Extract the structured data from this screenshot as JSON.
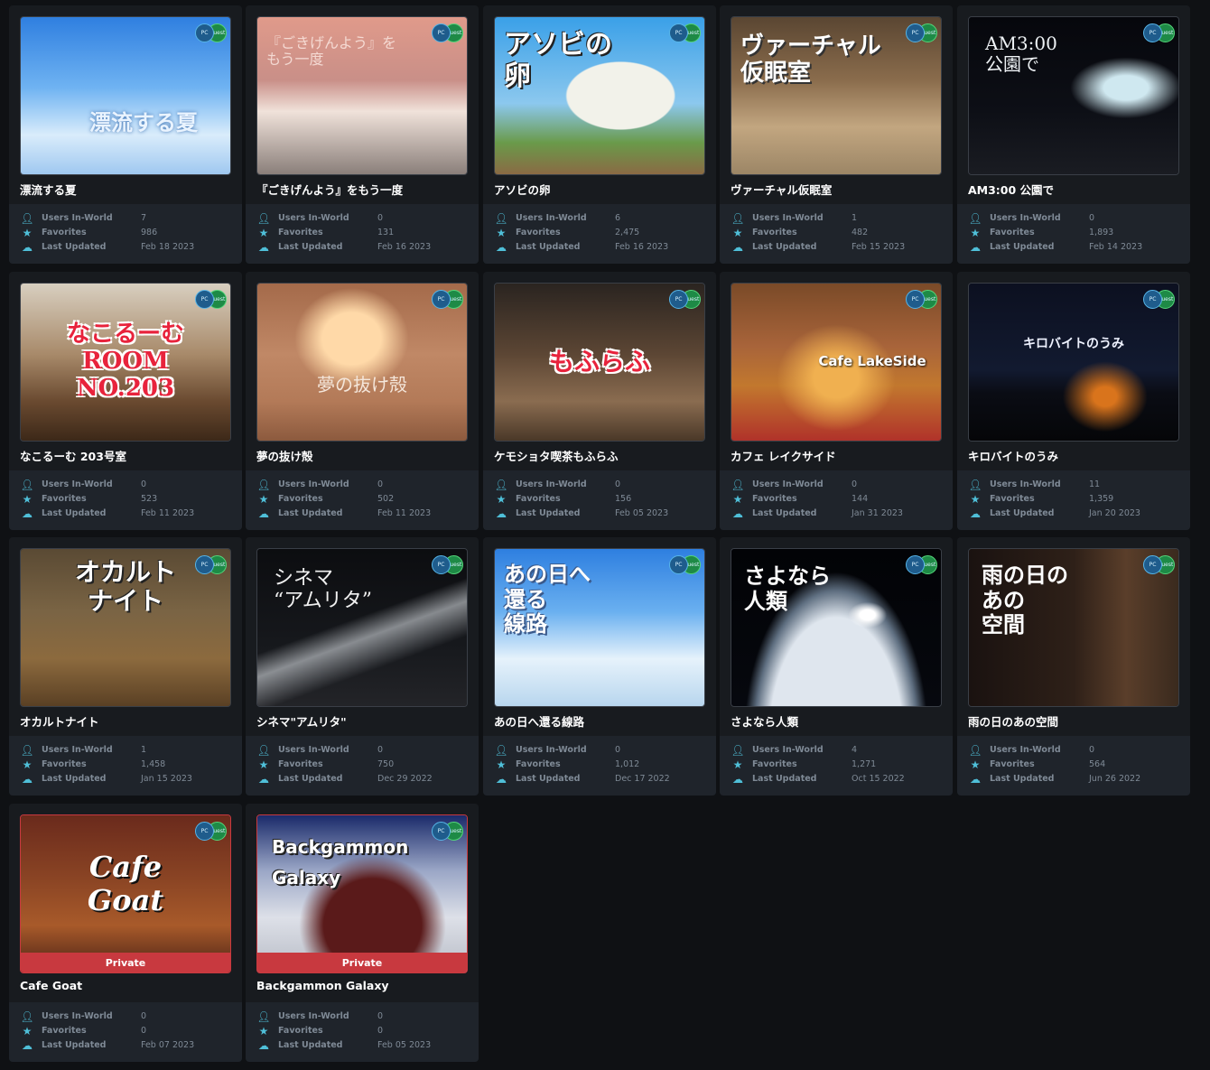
{
  "labels": {
    "users": "Users In-World",
    "favorites": "Favorites",
    "updated": "Last Updated",
    "pc": "PC",
    "quest": "Quest"
  },
  "icons": [
    "user-icon",
    "star-icon",
    "upload-cloud-icon",
    "pc-badge-icon",
    "quest-badge-icon"
  ],
  "worlds": [
    {
      "title": "漂流する夏",
      "users": "7",
      "favorites": "986",
      "updated": "Feb 18 2023",
      "art": "漂流する夏",
      "private": ""
    },
    {
      "title": "『ごきげんよう』をもう一度",
      "users": "0",
      "favorites": "131",
      "updated": "Feb 16 2023",
      "art": "『ごきげんよう』を\nもう一度",
      "private": ""
    },
    {
      "title": "アソビの卵",
      "users": "6",
      "favorites": "2,475",
      "updated": "Feb 16 2023",
      "art": "アソビの\n卵",
      "private": ""
    },
    {
      "title": "ヴァーチャル仮眠室",
      "users": "1",
      "favorites": "482",
      "updated": "Feb 15 2023",
      "art": "ヴァーチャル\n仮眠室",
      "private": ""
    },
    {
      "title": "AM3:00 公園で",
      "users": "0",
      "favorites": "1,893",
      "updated": "Feb 14 2023",
      "art": "AM3:00\n公園で",
      "private": ""
    },
    {
      "title": "なこるーむ 203号室",
      "users": "0",
      "favorites": "523",
      "updated": "Feb 11 2023",
      "art": "なこるーむ\nROOM NO.203",
      "private": ""
    },
    {
      "title": "夢の抜け殻",
      "users": "0",
      "favorites": "502",
      "updated": "Feb 11 2023",
      "art": "夢の抜け殻",
      "private": ""
    },
    {
      "title": "ケモショタ喫茶もふらふ",
      "users": "0",
      "favorites": "156",
      "updated": "Feb 05 2023",
      "art": "もふらふ",
      "private": ""
    },
    {
      "title": "カフェ レイクサイド",
      "users": "0",
      "favorites": "144",
      "updated": "Jan 31 2023",
      "art": "Cafe LakeSide",
      "private": ""
    },
    {
      "title": "キロバイトのうみ",
      "users": "11",
      "favorites": "1,359",
      "updated": "Jan 20 2023",
      "art": "キロバイトのうみ",
      "private": ""
    },
    {
      "title": "オカルトナイト",
      "users": "1",
      "favorites": "1,458",
      "updated": "Jan 15 2023",
      "art": "オカルト\nナイト",
      "private": ""
    },
    {
      "title": "シネマ\"アムリタ\"",
      "users": "0",
      "favorites": "750",
      "updated": "Dec 29 2022",
      "art": "シネマ\n“アムリタ”",
      "private": ""
    },
    {
      "title": "あの日へ還る線路",
      "users": "0",
      "favorites": "1,012",
      "updated": "Dec 17 2022",
      "art": "あの日へ\n還る\n線路",
      "private": ""
    },
    {
      "title": "さよなら人類",
      "users": "4",
      "favorites": "1,271",
      "updated": "Oct 15 2022",
      "art": "さよなら\n人類",
      "private": ""
    },
    {
      "title": "雨の日のあの空間",
      "users": "0",
      "favorites": "564",
      "updated": "Jun 26 2022",
      "art": "雨の日の\nあの\n空間",
      "private": ""
    },
    {
      "title": "Cafe Goat",
      "users": "0",
      "favorites": "0",
      "updated": "Feb 07 2023",
      "art": "Cafe\nGoat",
      "private": "Private"
    },
    {
      "title": "Backgammon Galaxy",
      "users": "0",
      "favorites": "0",
      "updated": "Feb 05 2023",
      "art": "Backgammon\nGalaxy",
      "private": "Private"
    }
  ]
}
